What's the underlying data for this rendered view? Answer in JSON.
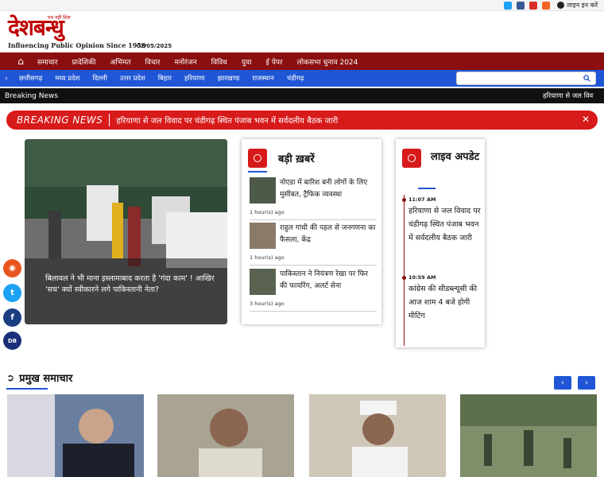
{
  "header": {
    "login_label": "लाइन इन करें",
    "social_top": [
      {
        "icon": "twitter-icon",
        "color": "#1da1f2"
      },
      {
        "icon": "facebook-icon",
        "color": "#3b5998"
      },
      {
        "icon": "youtube-icon",
        "color": "#d9302b"
      },
      {
        "icon": "rss-icon",
        "color": "#f26522"
      }
    ],
    "logo_text": "देशबन्धु",
    "logo_tagline_small": "पथ नहीं शिल",
    "logo_subtitle": "Influencing Public Opinion Since 1959",
    "date": "02/05/2025"
  },
  "main_nav": {
    "home_icon": "home-icon",
    "items": [
      "समाचार",
      "प्रादेशिकी",
      "अभिमत",
      "विचार",
      "मनोरंजन",
      "विविध",
      "युवा",
      "ई पेपर",
      "लोकसभा चुनाव 2024"
    ]
  },
  "state_nav": {
    "items": [
      "छत्तीसगढ़",
      "मध्य प्रदेश",
      "दिल्ली",
      "उत्तर प्रदेश",
      "बिहार",
      "हरियाणा",
      "झारखण्ड",
      "राजस्थान",
      "चंडीगढ़"
    ],
    "search_placeholder": ""
  },
  "ticker": {
    "label": "Breaking News",
    "text": "हरियाणा से जल विव"
  },
  "breaking_bar": {
    "label": "BREAKING NEWS",
    "text": "हरियाणा से जल विवाद पर चंडीगढ़ स्थित पंजाब भवन में सर्वदलीय बैठक जारी",
    "close_icon": "close-icon"
  },
  "hero": {
    "caption": "बिलावल ने भी माना इस्लामाबाद करता है 'गंदा काम' ! आखिर 'सच' क्यों स्वीकारने लगे पाकिस्तानी नेता?"
  },
  "side_social": [
    {
      "icon": "rss-icon",
      "color": "#e8561e",
      "label": ""
    },
    {
      "icon": "twitter-icon",
      "color": "#1da1f2",
      "label": ""
    },
    {
      "icon": "facebook-icon",
      "color": "#1a3e82",
      "label": ""
    },
    {
      "icon": "db-live-icon",
      "color": "#1a2f78",
      "label": "DB"
    }
  ],
  "top_news": {
    "title": "बड़ी ख़बरें",
    "items": [
      {
        "title": "नोएडा में बारिश बनी लोगों के लिए मुसीबत, ट्रैफिक व्यवस्था",
        "time": "1 hour(s) ago"
      },
      {
        "title": "राहुल गांधी की पहल से जनगणना का फैसला, केंद्र",
        "time": "1 hour(s) ago"
      },
      {
        "title": "पाकिस्तान ने नियंत्रण रेखा पर फिर की फायरिंग, अलर्ट सेना",
        "time": "3 hour(s) ago"
      }
    ]
  },
  "live_updates": {
    "title": "लाइव अपडेट",
    "items": [
      {
        "time": "11:07 AM",
        "text": "हरियाणा से जल विवाद पर चंडीगढ़ स्थित पंजाब भवन में सर्वदलीय बैठक जारी"
      },
      {
        "time": "10:59 AM",
        "text": "कांग्रेस की सीडब्ल्यूसी की आज शाम 4 बजे होगी मीटिंग"
      }
    ]
  },
  "section": {
    "title": "प्रमुख समाचार",
    "prev_icon": "chevron-left-icon",
    "next_icon": "chevron-right-icon"
  }
}
